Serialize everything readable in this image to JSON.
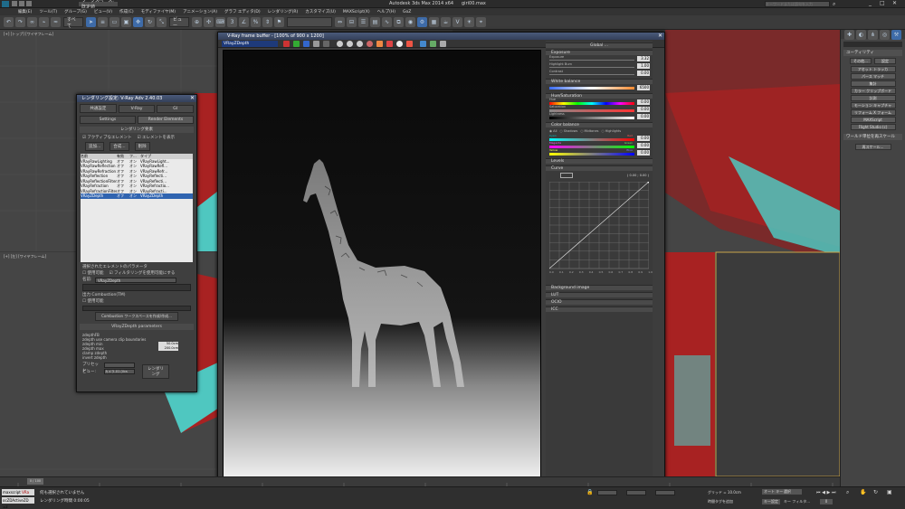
{
  "window": {
    "app_title": "Autodesk 3ds Max  2014 x64",
    "file_name": "giri00.max",
    "workspace": "ワークスペース: 既定値",
    "search_placeholder": "キーワードまたは語句を入力"
  },
  "menu": [
    "編集(E)",
    "ツール(T)",
    "グループ(G)",
    "ビュー(V)",
    "作成(C)",
    "モディファイヤ(M)",
    "アニメーション(A)",
    "グラフ エディタ(D)",
    "レンダリング(R)",
    "カスタマイズ(U)",
    "MAXScript(X)",
    "ヘルプ(H)",
    "GoZ"
  ],
  "toolbar": {
    "selection_filter": "すべて",
    "view_dropdown": "ビュー"
  },
  "viewports": {
    "top_left_label": "[+] [トップ] [ワイヤフレーム]",
    "bottom_left_label": "[+] [左] [ワイヤフレーム]"
  },
  "command_panel": {
    "section_title": "ユーティリティ",
    "top_buttons": [
      "その他...",
      "設定"
    ],
    "buttons": [
      "アセット トラッカ",
      "パース マッチ",
      "集計",
      "カラー クリップボード",
      "計測",
      "モーション キャプチャ",
      "リフォーム X フォーム",
      "MAXScript",
      "Flight Studio (c)"
    ],
    "section2": "ワールド単位を再スケール",
    "rescale_button": "再スケール..."
  },
  "render_setup": {
    "title": "レンダリング設定:  V-Ray Adv 2.40.03",
    "tabs_row1": [
      "共通設定",
      "V-Ray",
      "GI"
    ],
    "tabs_row2": [
      "Settings",
      "Render Elements"
    ],
    "section": "レンダリング要素",
    "check_active": "アクティブなエレメント",
    "check_display": "エレメントを表示",
    "btn_add": "追加...",
    "btn_merge": "合成...",
    "btn_delete": "削除",
    "table_headers": [
      "名前",
      "有効",
      "フ...",
      "タイプ"
    ],
    "rows": [
      [
        "VRayRawLighting",
        "オフ",
        "オン",
        "VRayRawLight..."
      ],
      [
        "VRayRawReflection",
        "オフ",
        "オン",
        "VRayRawRefl..."
      ],
      [
        "VRayRawRefraction",
        "オフ",
        "オン",
        "VRayRawRefr..."
      ],
      [
        "VRayReflection",
        "オフ",
        "オン",
        "VRayReflecti..."
      ],
      [
        "VRayReflectionFilter",
        "オフ",
        "オン",
        "VRayReflecti..."
      ],
      [
        "VRayRefraction",
        "オフ",
        "オン",
        "VRayRefractio..."
      ],
      [
        "VRayRefractionFilter",
        "オフ",
        "オン",
        "VRayRefracti..."
      ],
      [
        "VRayZDepth",
        "オフ",
        "オン",
        "VRayZDepth"
      ]
    ],
    "params_section": "選択されたエレメントのパラメータ",
    "check_enable": "使用可能",
    "check_filter": "フィルタリングを使用可能にする",
    "name_label": "名前:",
    "name_value": "VRayZDepth",
    "combustion_label": "出力 Combustion(TM)",
    "combustion_enable": "使用可能",
    "combustion_btn": "Combustion ワークスペースを作成/作成...",
    "zdepth_section": "VRayZDepth parameters",
    "params": [
      "zdepthFB",
      "zdepth use camera clip boundaries",
      "zdepth min",
      "zdepth max",
      "clamp zdepth",
      "invert zdepth"
    ],
    "zdepth_min": "50.0cm",
    "zdepth_max": "200.0cm",
    "preset_label": "プリセット:",
    "view_label": "ビュー:",
    "view_value": "カメラ-01 (Vra",
    "render_btn": "レンダリング"
  },
  "vfb": {
    "title": "V-Ray frame buffer - [100% of 900 x 1200]",
    "channel": "VRayZDepth",
    "cc": {
      "global": "Global ...",
      "exposure": "Exposure",
      "exposure_label": "Exposure",
      "exposure_val": "3.32",
      "highlight_label": "Highlight Burn",
      "highlight_val": "1.00",
      "contrast_label": "Contrast",
      "contrast_val": "0.00",
      "white_balance": "White balance",
      "wb_val": "6500",
      "huesat": "Hue/Saturation",
      "hue_label": "Hue",
      "hue_val": "0.00",
      "sat_label": "Saturation",
      "sat_val": "0.00",
      "light_label": "Lightness",
      "light_val": "0.00",
      "color_balance": "Color balance",
      "cb_all": "All",
      "cb_shadows": "Shadows",
      "cb_midtones": "Midtones",
      "cb_highlights": "Highlights",
      "cyan": "Cyan",
      "red": "Red",
      "magenta": "Magenta",
      "green": "Green",
      "yellow": "Yellow",
      "blue": "Blue",
      "cb_val1": "0.00",
      "cb_val2": "0.00",
      "cb_val3": "0.00",
      "levels": "Levels",
      "curve": "Curve",
      "curve_readout": "( 0.00 ; 0.00 )",
      "curve_ticks": [
        "0.0",
        "0.1",
        "0.2",
        "0.3",
        "0.4",
        "0.5",
        "0.6",
        "0.7",
        "0.8",
        "0.9",
        "1.0"
      ],
      "background_image": "Background image",
      "lut": "LUT",
      "ocio": "OCIO",
      "icc": "ICC"
    }
  },
  "status": {
    "script_label": "maxscript",
    "script_value": "VRa",
    "listener": "ocZDActiveZD =z",
    "status1": "何も選択されていません",
    "status2": "レンダリング時間  0:00:05",
    "grid": "グリッド = 10.0cm",
    "add_time_tag": "時間タグを追加",
    "auto_key": "オート キー",
    "selected": "選択",
    "set_key": "キー設定",
    "key_filters": "キー フィルタ...",
    "frame": "0 / 100",
    "frame_counter": "0"
  },
  "colors": {
    "accent": "#3e6ba8",
    "panel": "#3d3d3d",
    "viewport_red": "#b32424",
    "viewport_cyan": "#4fc7c0"
  }
}
